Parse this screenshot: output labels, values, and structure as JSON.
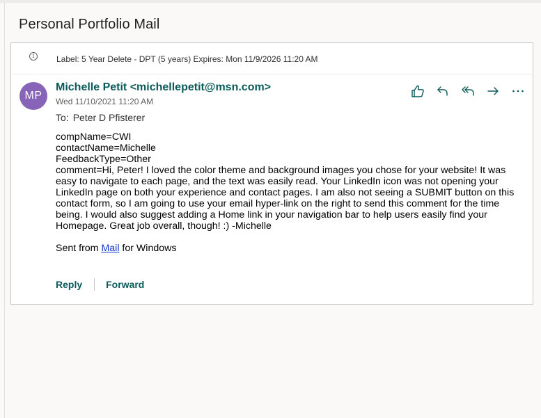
{
  "message": {
    "subject": "Personal Portfolio Mail",
    "retention_label": "Label: 5 Year Delete - DPT (5 years) Expires: Mon 11/9/2026 11:20 AM",
    "avatar_initials": "MP",
    "avatar_color": "#8764b8",
    "sender": "Michelle Petit <michellepetit@msn.com>",
    "sent_date": "Wed 11/10/2021 11:20 AM",
    "to_label": "To:",
    "to_value": "Peter D Pfisterer",
    "body_lines": [
      "compName=CWI",
      "contactName=Michelle",
      "FeedbackType=Other"
    ],
    "comment": "comment=Hi, Peter! I loved the color theme and background images you chose for your website! It was easy to navigate to each page, and the text was easily read. Your LinkedIn icon was not opening your LinkedIn page on both your experience and contact pages. I am also not seeing a SUBMIT button on this contact form, so I am going to use your email hyper-link on the right to send this comment for the time being. I would also suggest adding a Home link in your navigation bar to help users easily find your Homepage. Great job overall, though! :) -Michelle",
    "signature_prefix": "Sent from ",
    "signature_link": "Mail",
    "signature_suffix": " for Windows"
  },
  "toolbar": {
    "icons": [
      "like-icon",
      "reply-icon",
      "reply-all-icon",
      "forward-icon",
      "more-icon"
    ]
  },
  "footer": {
    "reply_label": "Reply",
    "forward_label": "Forward"
  },
  "colors": {
    "accent": "#0b5a5a",
    "link": "#0f36cc"
  }
}
